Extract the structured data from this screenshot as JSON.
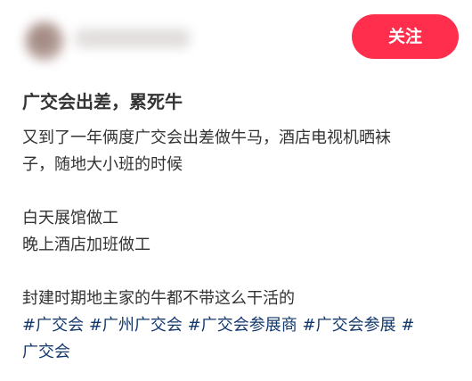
{
  "header": {
    "follow_label": "关注"
  },
  "post": {
    "title": "广交会出差，累死牛",
    "body_lines": [
      "又到了一年俩度广交会出差做牛马，酒店电视机晒袜",
      "子，随地大小班的时候",
      "",
      "白天展馆做工",
      "晚上酒店加班做工",
      "",
      "封建时期地主家的牛都不带这么干活的"
    ],
    "tags": [
      "#广交会",
      "#广州广交会",
      "#广交会参展商",
      "#广交会参展",
      "#",
      "广交会"
    ]
  },
  "colors": {
    "follow_button": "#ff2e4d",
    "tag_link": "#13386c",
    "text": "#333333"
  }
}
